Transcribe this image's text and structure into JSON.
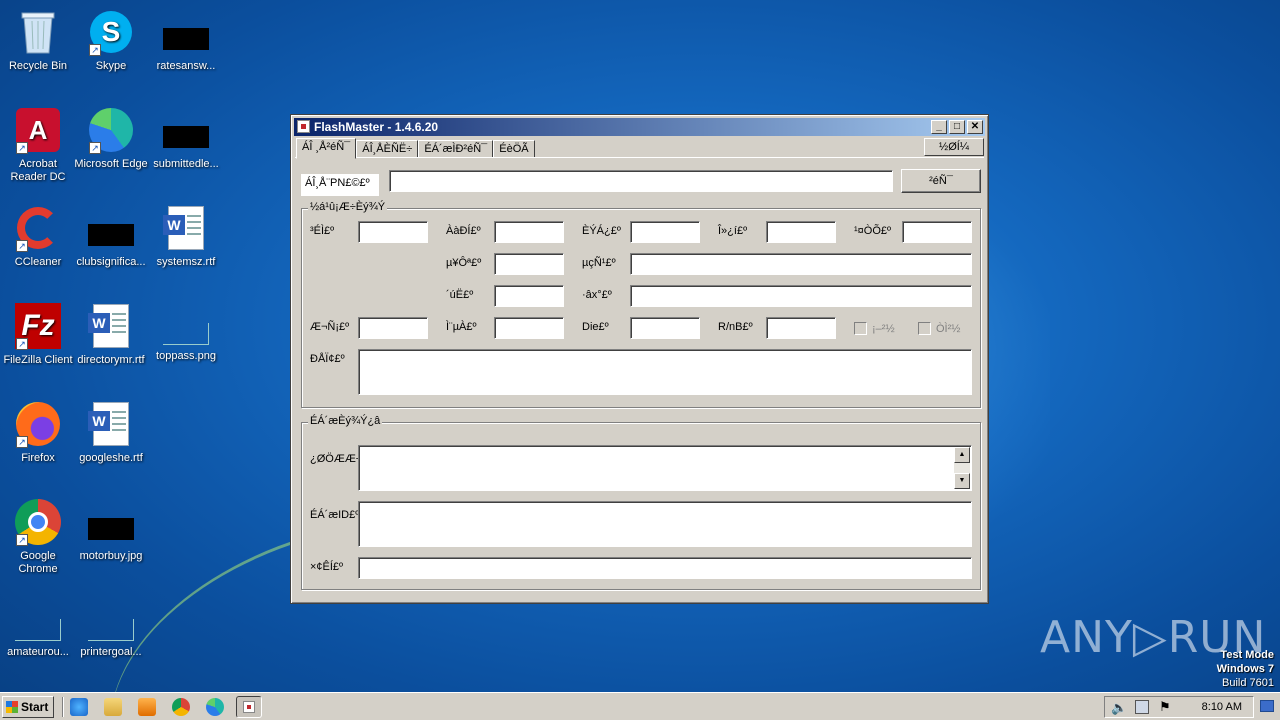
{
  "desktop": {
    "icons": [
      {
        "label": "Recycle Bin",
        "icon": "recycle-bin-icon"
      },
      {
        "label": "Skype",
        "icon": "skype-icon"
      },
      {
        "label": "ratesansw...",
        "icon": "image-thumbnail-icon"
      },
      {
        "label": "Acrobat Reader DC",
        "icon": "acrobat-icon"
      },
      {
        "label": "Microsoft Edge",
        "icon": "edge-icon"
      },
      {
        "label": "submittedle...",
        "icon": "image-thumbnail-icon"
      },
      {
        "label": "CCleaner",
        "icon": "ccleaner-icon"
      },
      {
        "label": "clubsignifica...",
        "icon": "image-thumbnail-icon"
      },
      {
        "label": "systemsz.rtf",
        "icon": "word-document-icon"
      },
      {
        "label": "FileZilla Client",
        "icon": "filezilla-icon"
      },
      {
        "label": "directorymr.rtf",
        "icon": "word-document-icon"
      },
      {
        "label": "toppass.png",
        "icon": "image-file-icon"
      },
      {
        "label": "Firefox",
        "icon": "firefox-icon"
      },
      {
        "label": "googleshe.rtf",
        "icon": "word-document-icon"
      },
      {
        "label": "Google Chrome",
        "icon": "chrome-icon"
      },
      {
        "label": "motorbuy.jpg",
        "icon": "image-thumbnail-icon"
      },
      {
        "label": "amateurou...",
        "icon": "image-file-icon"
      },
      {
        "label": "printergoal...",
        "icon": "image-file-icon"
      }
    ]
  },
  "window": {
    "title": "FlashMaster - 1.4.6.20",
    "controls": {
      "minimize": "_",
      "maximize": "□",
      "close": "✕"
    },
    "tabs": [
      "ÁÎ ¸Å²éÑ¯",
      "ÁÎ¸ÅÈÑË÷",
      "ÉÁ´æÌÐ²éÑ¯",
      "ÉèÖÃ"
    ],
    "about_button": "½ØÍ¼",
    "search": {
      "label": "ÁÎ¸Å¨PN£©£º",
      "value": "",
      "button": "²éÑ¯"
    },
    "group1": {
      "title": "½á¹û¡Æ÷Èý¾Ý",
      "row1": [
        "³ÉÌ£º",
        "ÀàÐÍ£º",
        "ÈÝÁ¿£º",
        "Î»¿í£º",
        "¹¤ÒÕ£º"
      ],
      "row2": [
        "µ¥Ôª£º",
        "µçÑ¹£º"
      ],
      "row3": [
        "´úË£º",
        "·âx°£º"
      ],
      "row4": [
        "Æ¬Ñ¡£º",
        "Ì¨µÀ£º",
        "Die£º",
        "R/nB£º"
      ],
      "checks": [
        "¡–²½",
        "ÒÌ²½"
      ],
      "note_label": "ÐÅÏ¢£º"
    },
    "group2": {
      "title": "ÉÁ´æÈý¾Ý¿â",
      "labels": [
        "¿ØÖÆÆ÷",
        "ÉÁ´æID£º",
        "×¢ÊÍ£º"
      ]
    }
  },
  "watermark": {
    "brand": "ANY▷RUN",
    "mode_line1": "Test Mode",
    "mode_line2": "Windows 7",
    "mode_line3": "Build 7601"
  },
  "taskbar": {
    "start_label": "Start",
    "clock": "8:10 AM"
  }
}
